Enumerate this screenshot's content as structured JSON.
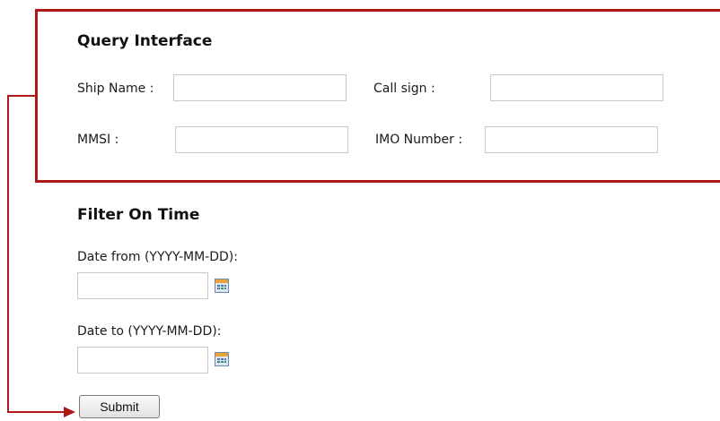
{
  "query_interface": {
    "title": "Query Interface",
    "ship_name": {
      "label": "Ship Name :",
      "value": ""
    },
    "call_sign": {
      "label": "Call sign :",
      "value": ""
    },
    "mmsi": {
      "label": "MMSI :",
      "value": ""
    },
    "imo_number": {
      "label": "IMO Number :",
      "value": ""
    }
  },
  "filter_on_time": {
    "title": "Filter On Time",
    "date_from": {
      "label": "Date from (YYYY-MM-DD):",
      "value": ""
    },
    "date_to": {
      "label": "Date to (YYYY-MM-DD):",
      "value": ""
    }
  },
  "submit": {
    "label": "Submit"
  },
  "icons": {
    "date_picker": "calendar-icon"
  },
  "colors": {
    "highlight": "#b01818"
  }
}
